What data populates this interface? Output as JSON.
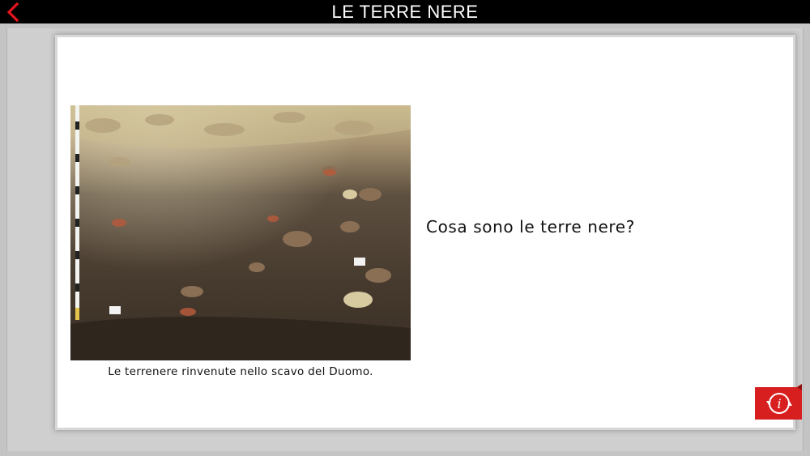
{
  "header": {
    "title": "LE TERRE NERE",
    "back_icon": "chevron-left-icon",
    "accent_color": "#e8141c"
  },
  "content": {
    "image_caption": "Le terrenere rinvenute nello scavo del Duomo.",
    "question": "Cosa sono le terre nere?"
  },
  "info_button": {
    "icon": "info-swap-icon",
    "color": "#d81f1f"
  }
}
